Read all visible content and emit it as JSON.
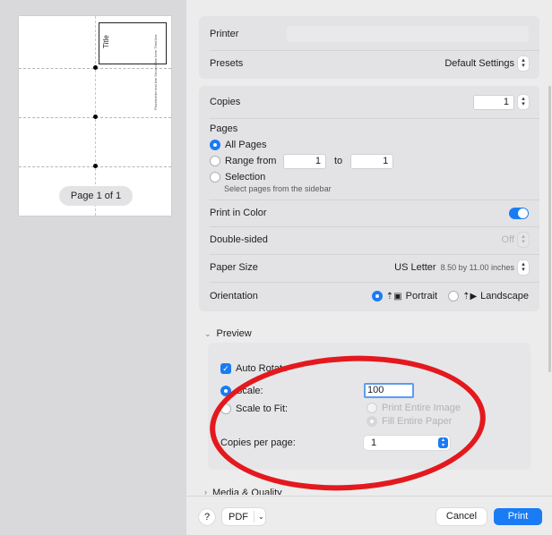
{
  "preview": {
    "title_text": "Title",
    "small_text": "Placeholder text line Second line here Third line",
    "page_indicator": "Page 1 of 1"
  },
  "header": {
    "printer_label": "Printer",
    "presets_label": "Presets",
    "presets_value": "Default Settings"
  },
  "copies": {
    "label": "Copies",
    "value": "1"
  },
  "pages": {
    "label": "Pages",
    "all_label": "All Pages",
    "range_label": "Range from",
    "range_from": "1",
    "range_to_label": "to",
    "range_to": "1",
    "selection_label": "Selection",
    "selection_hint": "Select pages from the sidebar"
  },
  "color": {
    "label": "Print in Color",
    "enabled": true
  },
  "double_sided": {
    "label": "Double-sided",
    "value": "Off"
  },
  "paper_size": {
    "label": "Paper Size",
    "value": "US Letter",
    "dimensions": "8.50 by 11.00 inches"
  },
  "orientation": {
    "label": "Orientation",
    "portrait": "Portrait",
    "landscape": "Landscape"
  },
  "preview_section": {
    "title": "Preview",
    "auto_rotate": "Auto Rotate",
    "scale_label": "Scale:",
    "scale_value": "100",
    "scale_to_fit": "Scale to Fit:",
    "print_entire_image": "Print Entire Image",
    "fill_entire_paper": "Fill Entire Paper",
    "copies_per_page_label": "Copies per page:",
    "copies_per_page_value": "1"
  },
  "media_quality": {
    "title": "Media & Quality"
  },
  "footer": {
    "help": "?",
    "pdf": "PDF",
    "cancel": "Cancel",
    "print": "Print"
  },
  "colors": {
    "accent": "#1a7cf5",
    "annotation": "#e3191e"
  }
}
